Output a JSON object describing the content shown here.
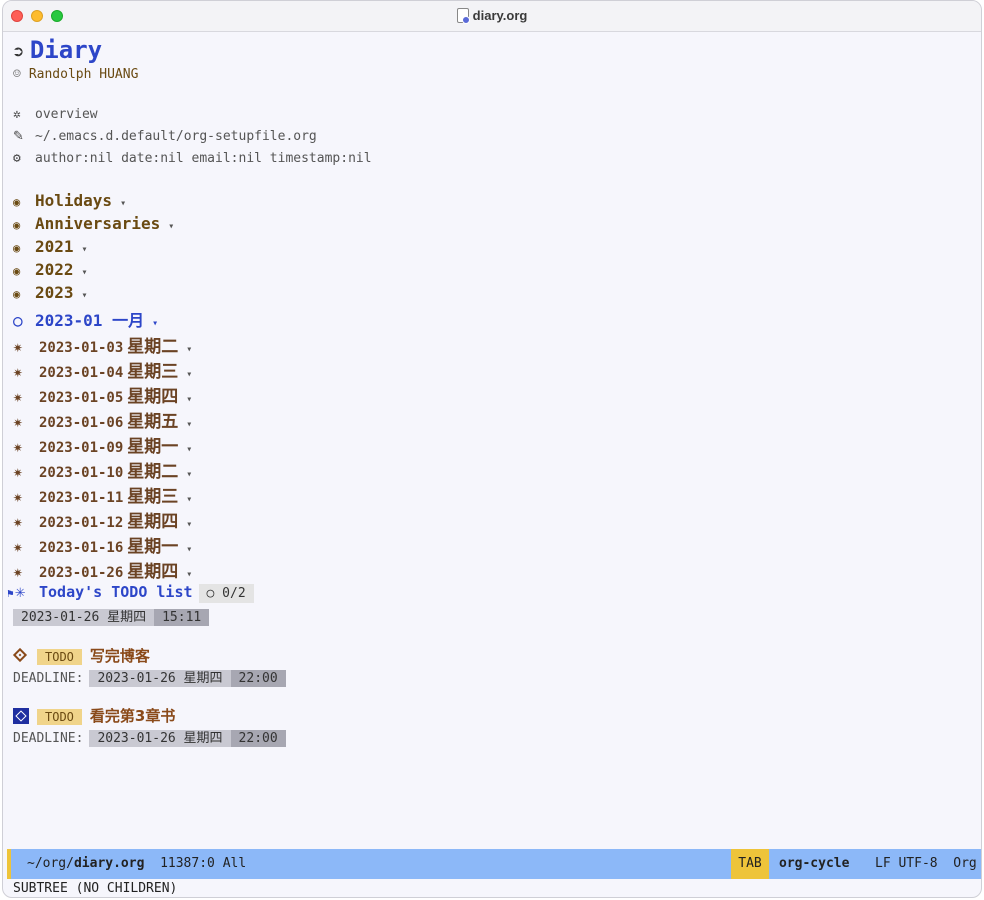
{
  "window": {
    "title": "diary.org"
  },
  "doc": {
    "title": "Diary",
    "author": "Randolph HUANG",
    "meta": [
      {
        "icon": "snowflake-icon",
        "glyph": "✲",
        "text": "overview"
      },
      {
        "icon": "file-edit-icon",
        "glyph": "📝",
        "text": "~/.emacs.d.default/org-setupfile.org"
      },
      {
        "icon": "gear-icon",
        "glyph": "⚙",
        "text": "author:nil date:nil email:nil timestamp:nil"
      }
    ]
  },
  "headings": [
    {
      "label": "Holidays"
    },
    {
      "label": "Anniversaries"
    },
    {
      "label": "2021"
    },
    {
      "label": "2022"
    },
    {
      "label": "2023"
    }
  ],
  "month": {
    "label": "2023-01 一月"
  },
  "days": [
    {
      "date": "2023-01-03",
      "weekday": "星期二"
    },
    {
      "date": "2023-01-04",
      "weekday": "星期三"
    },
    {
      "date": "2023-01-05",
      "weekday": "星期四"
    },
    {
      "date": "2023-01-06",
      "weekday": "星期五"
    },
    {
      "date": "2023-01-09",
      "weekday": "星期一"
    },
    {
      "date": "2023-01-10",
      "weekday": "星期二"
    },
    {
      "date": "2023-01-11",
      "weekday": "星期三"
    },
    {
      "date": "2023-01-12",
      "weekday": "星期四"
    },
    {
      "date": "2023-01-16",
      "weekday": "星期一"
    },
    {
      "date": "2023-01-26",
      "weekday": "星期四"
    }
  ],
  "todo_list": {
    "title": "Today's TODO list",
    "cookie": "○ 0/2",
    "timestamp_date": "2023-01-26 星期四",
    "timestamp_time": "15:11",
    "tasks": [
      {
        "keyword": "TODO",
        "title": "写完博客",
        "deadline_label": "DEADLINE:",
        "deadline_date": "2023-01-26 星期四",
        "deadline_time": "22:00"
      },
      {
        "keyword": "TODO",
        "title": "看完第3章书",
        "deadline_label": "DEADLINE:",
        "deadline_date": "2023-01-26 星期四",
        "deadline_time": "22:00"
      }
    ]
  },
  "modeline": {
    "path_prefix": "~/org/",
    "file": "diary.org",
    "position": "11387:0 All",
    "key": "TAB",
    "command": "org-cycle",
    "encoding": "LF UTF-8",
    "mode": "Org"
  },
  "echo": "SUBTREE (NO CHILDREN)",
  "colors": {
    "title_blue": "#2d46c8",
    "heading_brown": "#6a4a12",
    "modeline_bg": "#8cb8f8",
    "accent_yellow": "#eec43a",
    "todo_bg": "#f0d48a"
  }
}
